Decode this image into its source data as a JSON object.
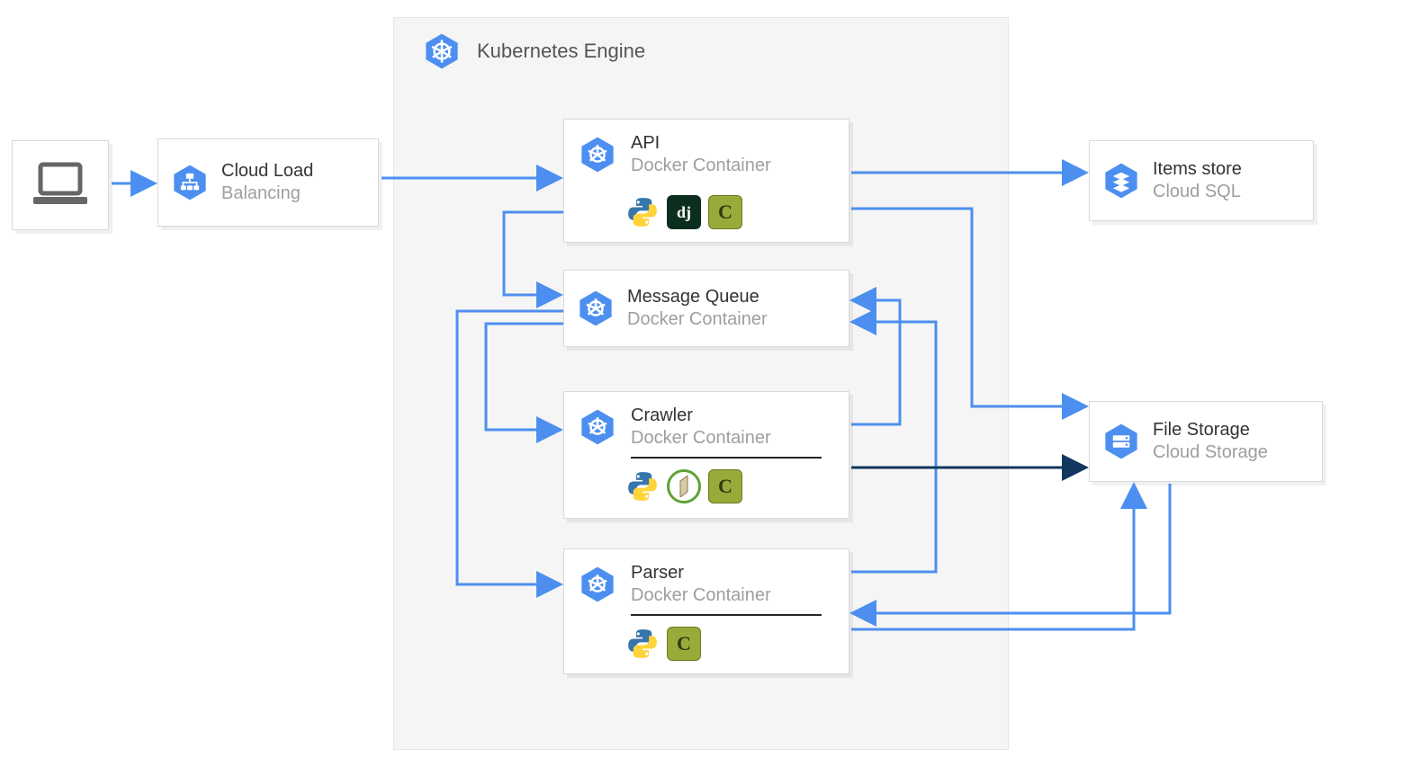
{
  "header": {
    "label": "Kubernetes Engine"
  },
  "nodes": {
    "laptop": {
      "icon": "laptop"
    },
    "lb": {
      "title": "Cloud Load",
      "subtitle": "Balancing",
      "icon": "load-balancer"
    },
    "api": {
      "title": "API",
      "subtitle": "Docker Container",
      "icon": "k8s",
      "tech": [
        "python",
        "django",
        "celery"
      ]
    },
    "mq": {
      "title": "Message Queue",
      "subtitle": "Docker Container",
      "icon": "k8s"
    },
    "crawler": {
      "title": "Crawler",
      "subtitle": "Docker Container",
      "icon": "k8s",
      "tech": [
        "python",
        "scrapy",
        "celery"
      ]
    },
    "parser": {
      "title": "Parser",
      "subtitle": "Docker Container",
      "icon": "k8s",
      "tech": [
        "python",
        "celery"
      ]
    },
    "items": {
      "title": "Items store",
      "subtitle": "Cloud SQL",
      "icon": "sql"
    },
    "files": {
      "title": "File Storage",
      "subtitle": "Cloud Storage",
      "icon": "storage"
    }
  },
  "colors": {
    "arrow": "#4d8ff0",
    "arrowDark": "#12375f",
    "hex": "#4d8ff0"
  }
}
